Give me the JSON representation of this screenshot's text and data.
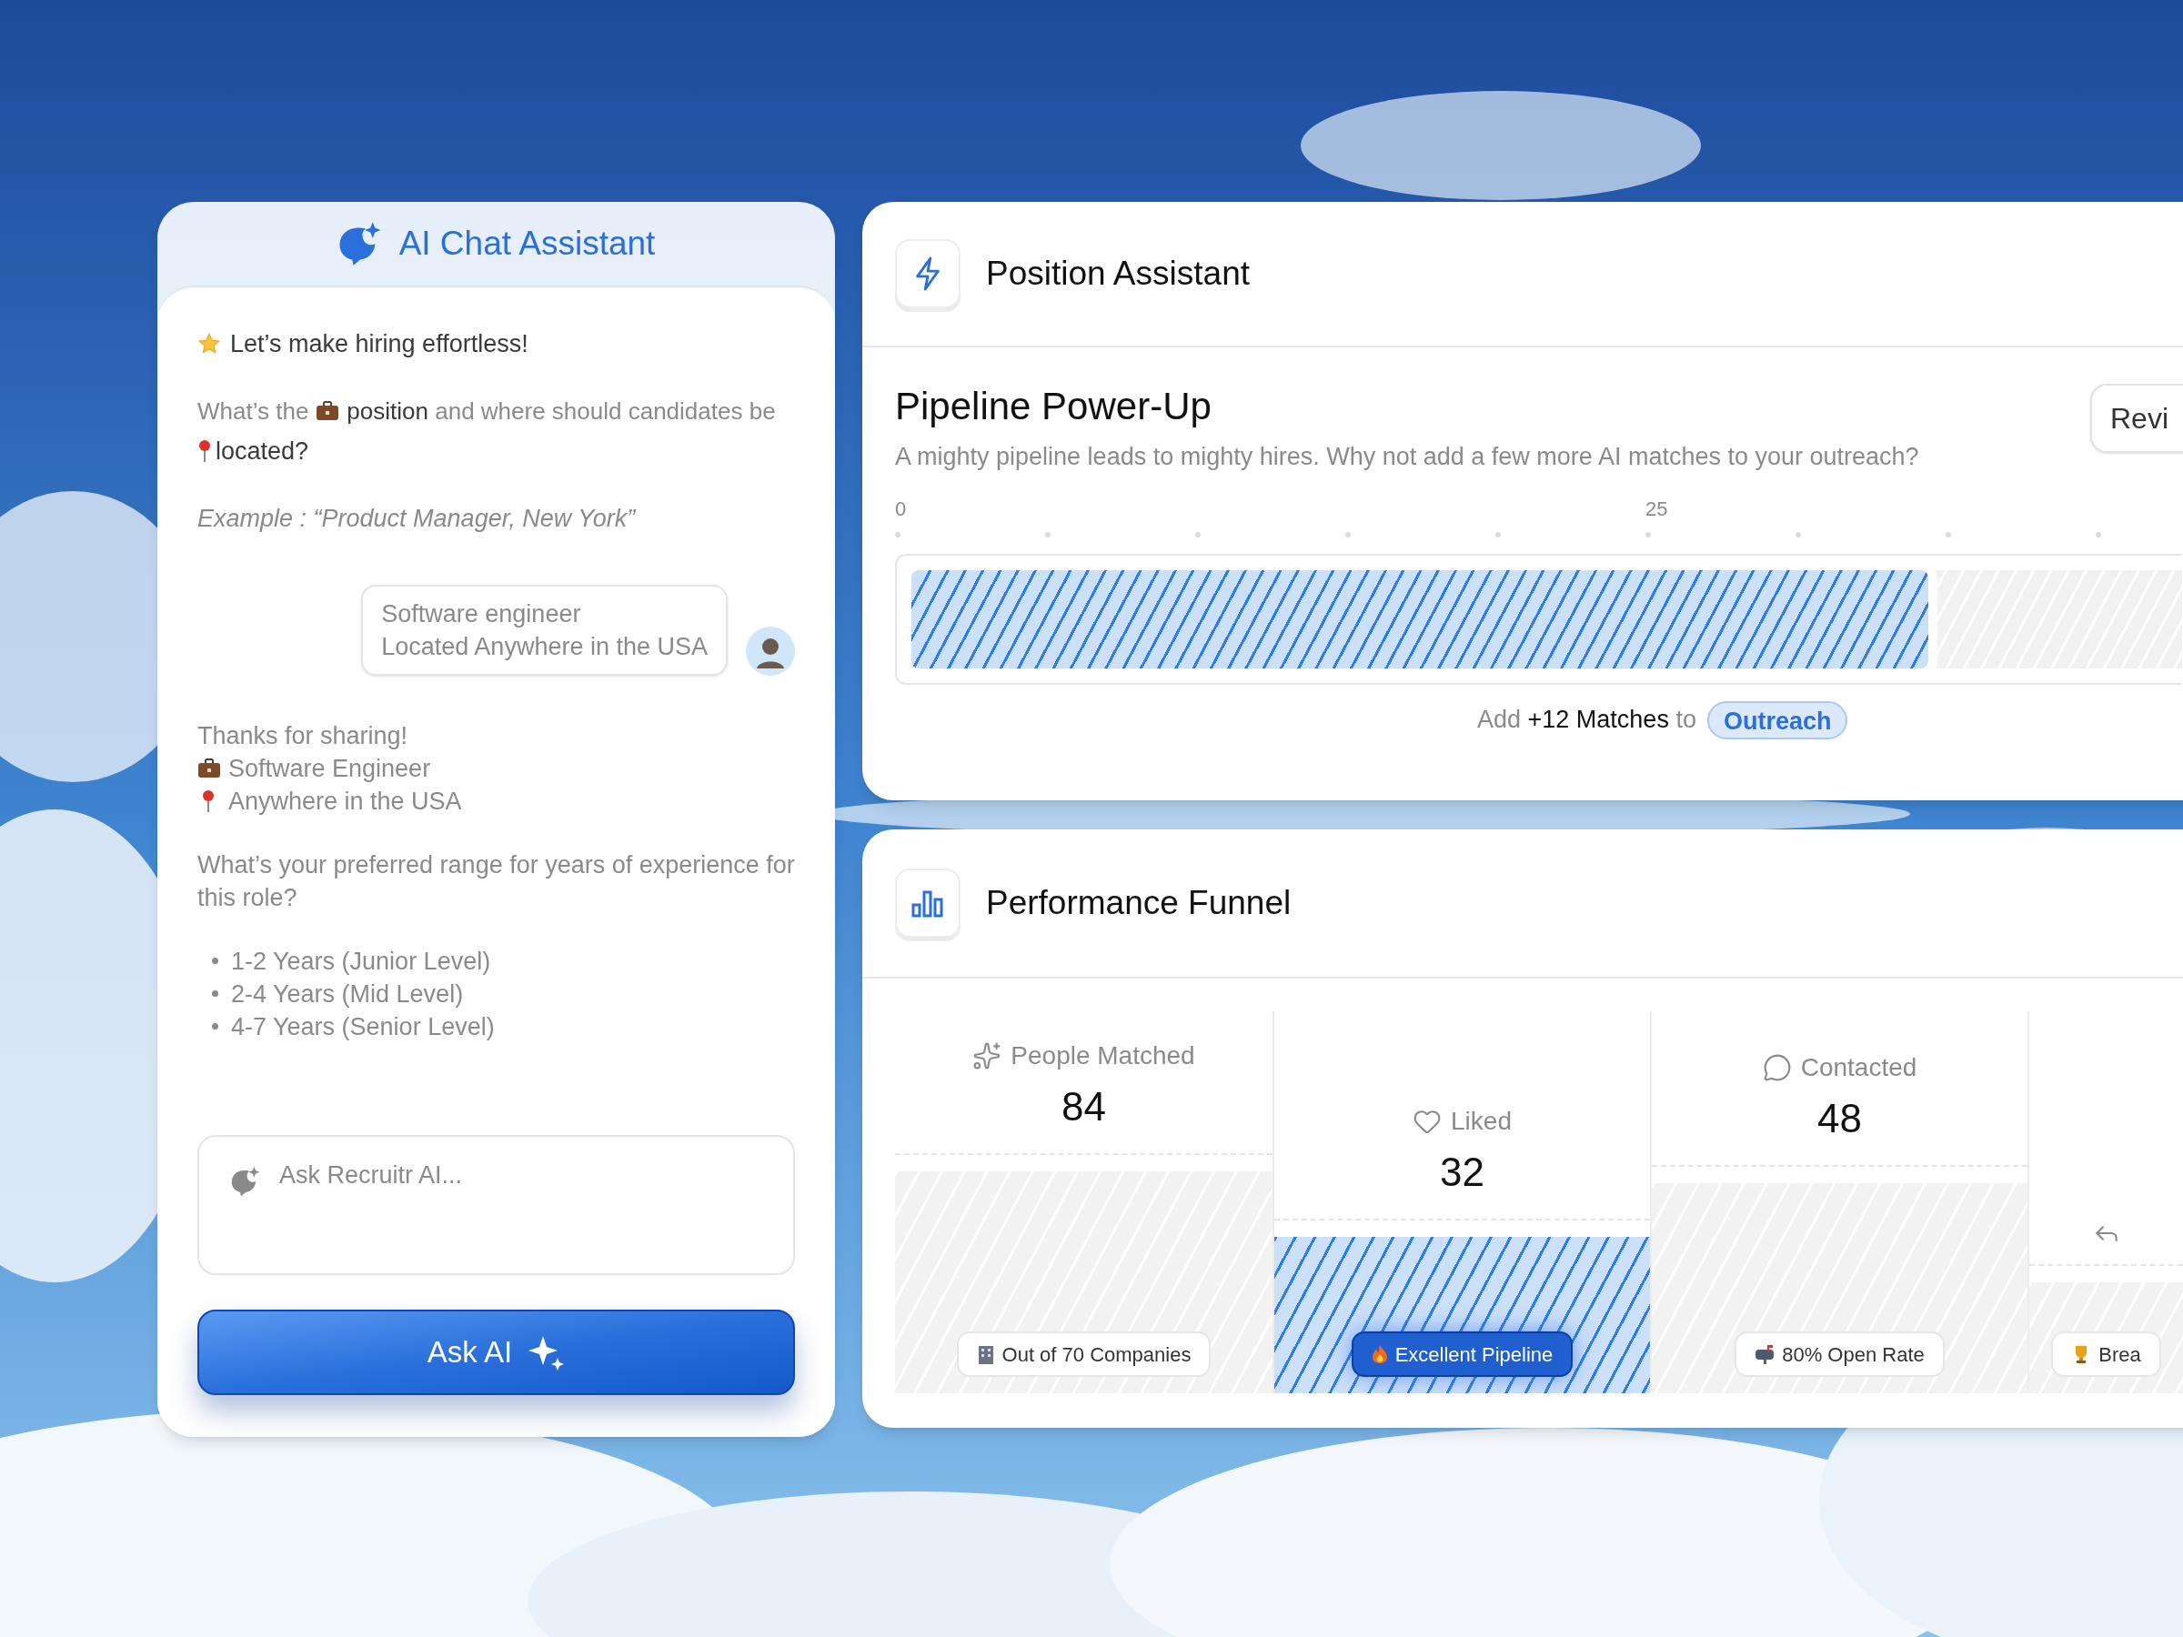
{
  "chat": {
    "title": "AI Chat Assistant",
    "greeting": "Let’s make hiring effortless!",
    "question": {
      "lead": "What’s the",
      "main": "**position** and where should candidates be",
      "end": "located?"
    },
    "example": "Example : “Product Manager, New York”",
    "user_reply": [
      "Software engineer",
      "Located Anywhere in the USA"
    ],
    "summary": {
      "intro": "Thanks for sharing!",
      "role": "Software Engineer",
      "location": "Anywhere in the USA"
    },
    "followup": "What’s your preferred range for years of experience for this role?",
    "options": [
      "1-2 Years (Junior Level)",
      "2-4 Years (Mid Level)",
      "4-7 Years (Senior Level)"
    ],
    "input": {
      "placeholder": "Ask Recruitr AI..."
    },
    "send_button": "Ask AI"
  },
  "position_assistant": {
    "title": "Position Assistant",
    "section_title": "Pipeline Power-Up",
    "description": "A mighty pipeline leads to mighty hires. Why not add a few more AI matches to your outreach?",
    "review_button": "Revi",
    "axis_ticks": [
      "0",
      "25"
    ],
    "pipeline_bar": {
      "level": 0.8
    },
    "cta": "Add **+12 Matches** to",
    "cta_chip": "Outreach"
  },
  "performance_funnel": {
    "title": "Performance Funnel",
    "stages": [
      {
        "label": "People Matched",
        "value": "84",
        "badge": "Out of 70 Companies",
        "selected": false,
        "level": 0.58
      },
      {
        "label": "Liked",
        "value": "32",
        "badge": "Excellent Pipeline",
        "selected": true,
        "level": 0.41
      },
      {
        "label": "Contacted",
        "value": "48",
        "badge": "80% Open Rate",
        "selected": false,
        "level": 0.55
      },
      {
        "badge": "Brea",
        "selected": false,
        "level": 0.29
      }
    ]
  }
}
